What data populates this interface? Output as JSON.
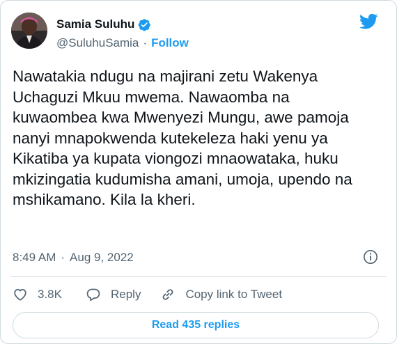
{
  "author": {
    "name": "Samia Suluhu",
    "handle": "@SuluhuSamia",
    "follow_label": "Follow",
    "separator": "·"
  },
  "tweet": {
    "text": "Nawatakia ndugu na majirani zetu Wakenya Uchaguzi Mkuu mwema. Nawaomba na kuwaombea kwa Mwenyezi Mungu, awe pamoja nanyi mnapokwenda kutekeleza haki yenu ya Kikatiba ya kupata viongozi mnaowataka, huku mkizingatia kudumisha amani, umoja, upendo na mshikamano. Kila la kheri.",
    "time": "8:49 AM",
    "separator": "·",
    "date": "Aug 9, 2022"
  },
  "actions": {
    "likes": "3.8K",
    "reply_label": "Reply",
    "copy_label": "Copy link to Tweet"
  },
  "footer": {
    "read_replies_label": "Read 435 replies"
  },
  "colors": {
    "accent": "#1d9bf0",
    "text": "#0f1419",
    "muted": "#536471",
    "border": "#cfd9de"
  },
  "icons": {
    "verified": "verified-badge-icon",
    "brand": "twitter-bird-icon",
    "info": "info-icon",
    "like": "heart-icon",
    "reply": "reply-bubble-icon",
    "copy": "link-icon"
  }
}
